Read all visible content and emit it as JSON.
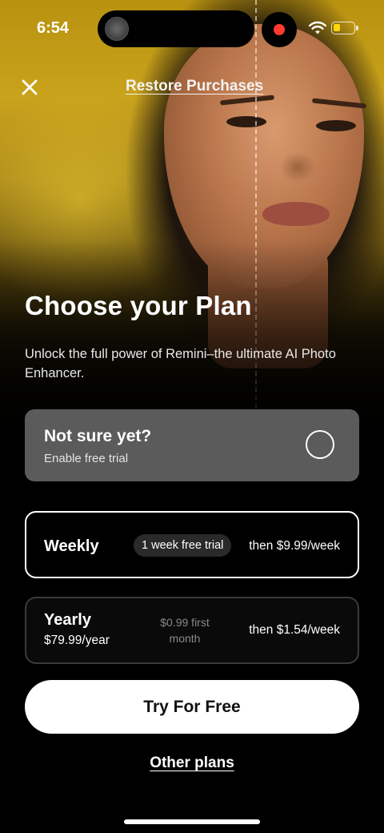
{
  "status_bar": {
    "time": "6:54",
    "battery_level": 0.35,
    "colors": {
      "battery": "#ffd60a",
      "recording": "#ff3b30"
    }
  },
  "nav": {
    "close_icon": "close-icon",
    "restore_label": "Restore Purchases"
  },
  "header": {
    "title": "Choose your Plan",
    "subtitle": "Unlock the full power of Remini–the ultimate AI Photo Enhancer."
  },
  "free_trial": {
    "title": "Not sure yet?",
    "subtitle": "Enable free trial",
    "enabled": false
  },
  "plans": [
    {
      "name": "Weekly",
      "badge": "1 week free trial",
      "then_price": "then $9.99/week",
      "selected": true
    },
    {
      "name": "Yearly",
      "price": "$79.99/year",
      "intro": "$0.99 first month",
      "then_price": "then $1.54/week",
      "selected": false
    }
  ],
  "cta": {
    "label": "Try For Free"
  },
  "footer": {
    "other_plans_label": "Other plans"
  }
}
